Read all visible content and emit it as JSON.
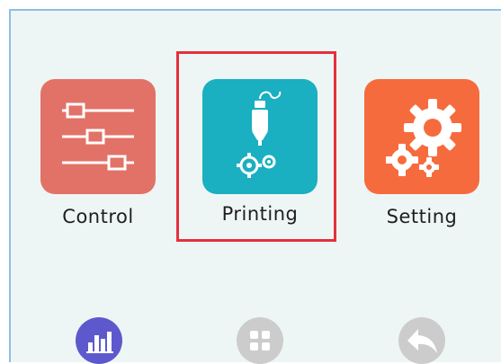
{
  "menu": {
    "items": [
      {
        "label": "Control",
        "icon": "sliders-icon",
        "color": "#e27267"
      },
      {
        "label": "Printing",
        "icon": "print-head-icon",
        "color": "#1aafc1",
        "selected": true
      },
      {
        "label": "Setting",
        "icon": "gears-icon",
        "color": "#f66b3e"
      }
    ]
  },
  "bottom_nav": [
    {
      "icon": "bar-chart-icon",
      "color": "#5d59cc"
    },
    {
      "icon": "grid-icon",
      "color": "#cccccc"
    },
    {
      "icon": "back-arrow-icon",
      "color": "#cccccc"
    }
  ],
  "colors": {
    "screen_bg": "#eef6f5",
    "highlight_border": "#e5303d"
  }
}
